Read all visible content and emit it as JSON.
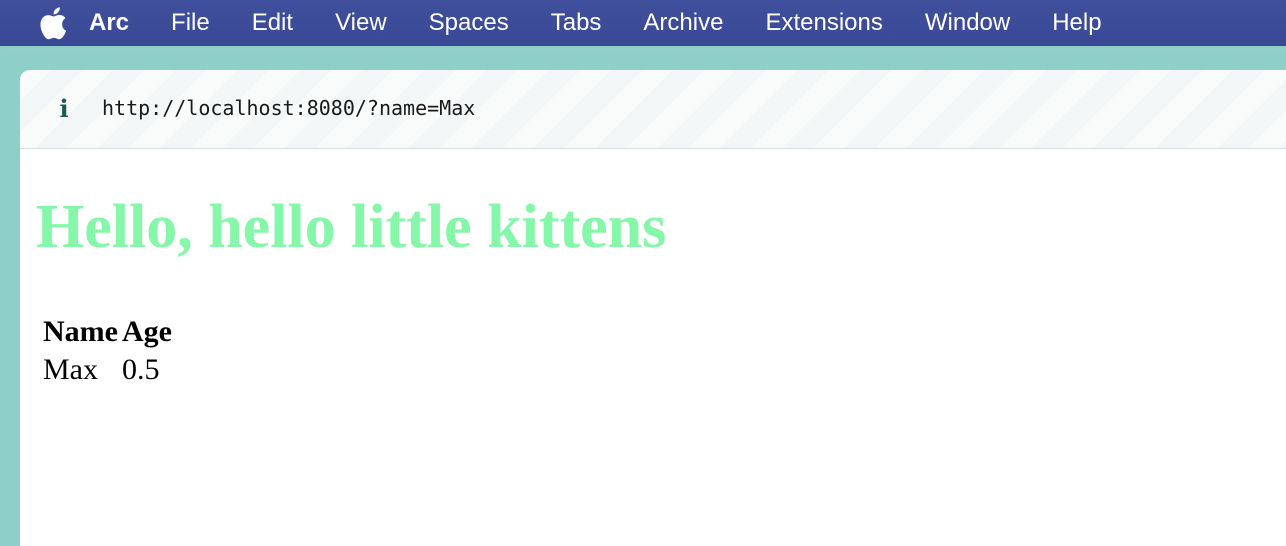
{
  "menubar": {
    "apple_icon": "apple-logo-icon",
    "app_name": "Arc",
    "items": [
      "File",
      "Edit",
      "View",
      "Spaces",
      "Tabs",
      "Archive",
      "Extensions",
      "Window",
      "Help"
    ]
  },
  "address_bar": {
    "info_icon": "i",
    "url": "http://localhost:8080/?name=Max"
  },
  "page": {
    "heading": "Hello, hello little kittens",
    "heading_color": "#85f7a9",
    "table": {
      "headers": [
        "Name",
        "Age"
      ],
      "rows": [
        [
          "Max",
          "0.5"
        ]
      ]
    }
  },
  "colors": {
    "menubar": "#3f4f9c",
    "frame": "#8ecfc8"
  }
}
